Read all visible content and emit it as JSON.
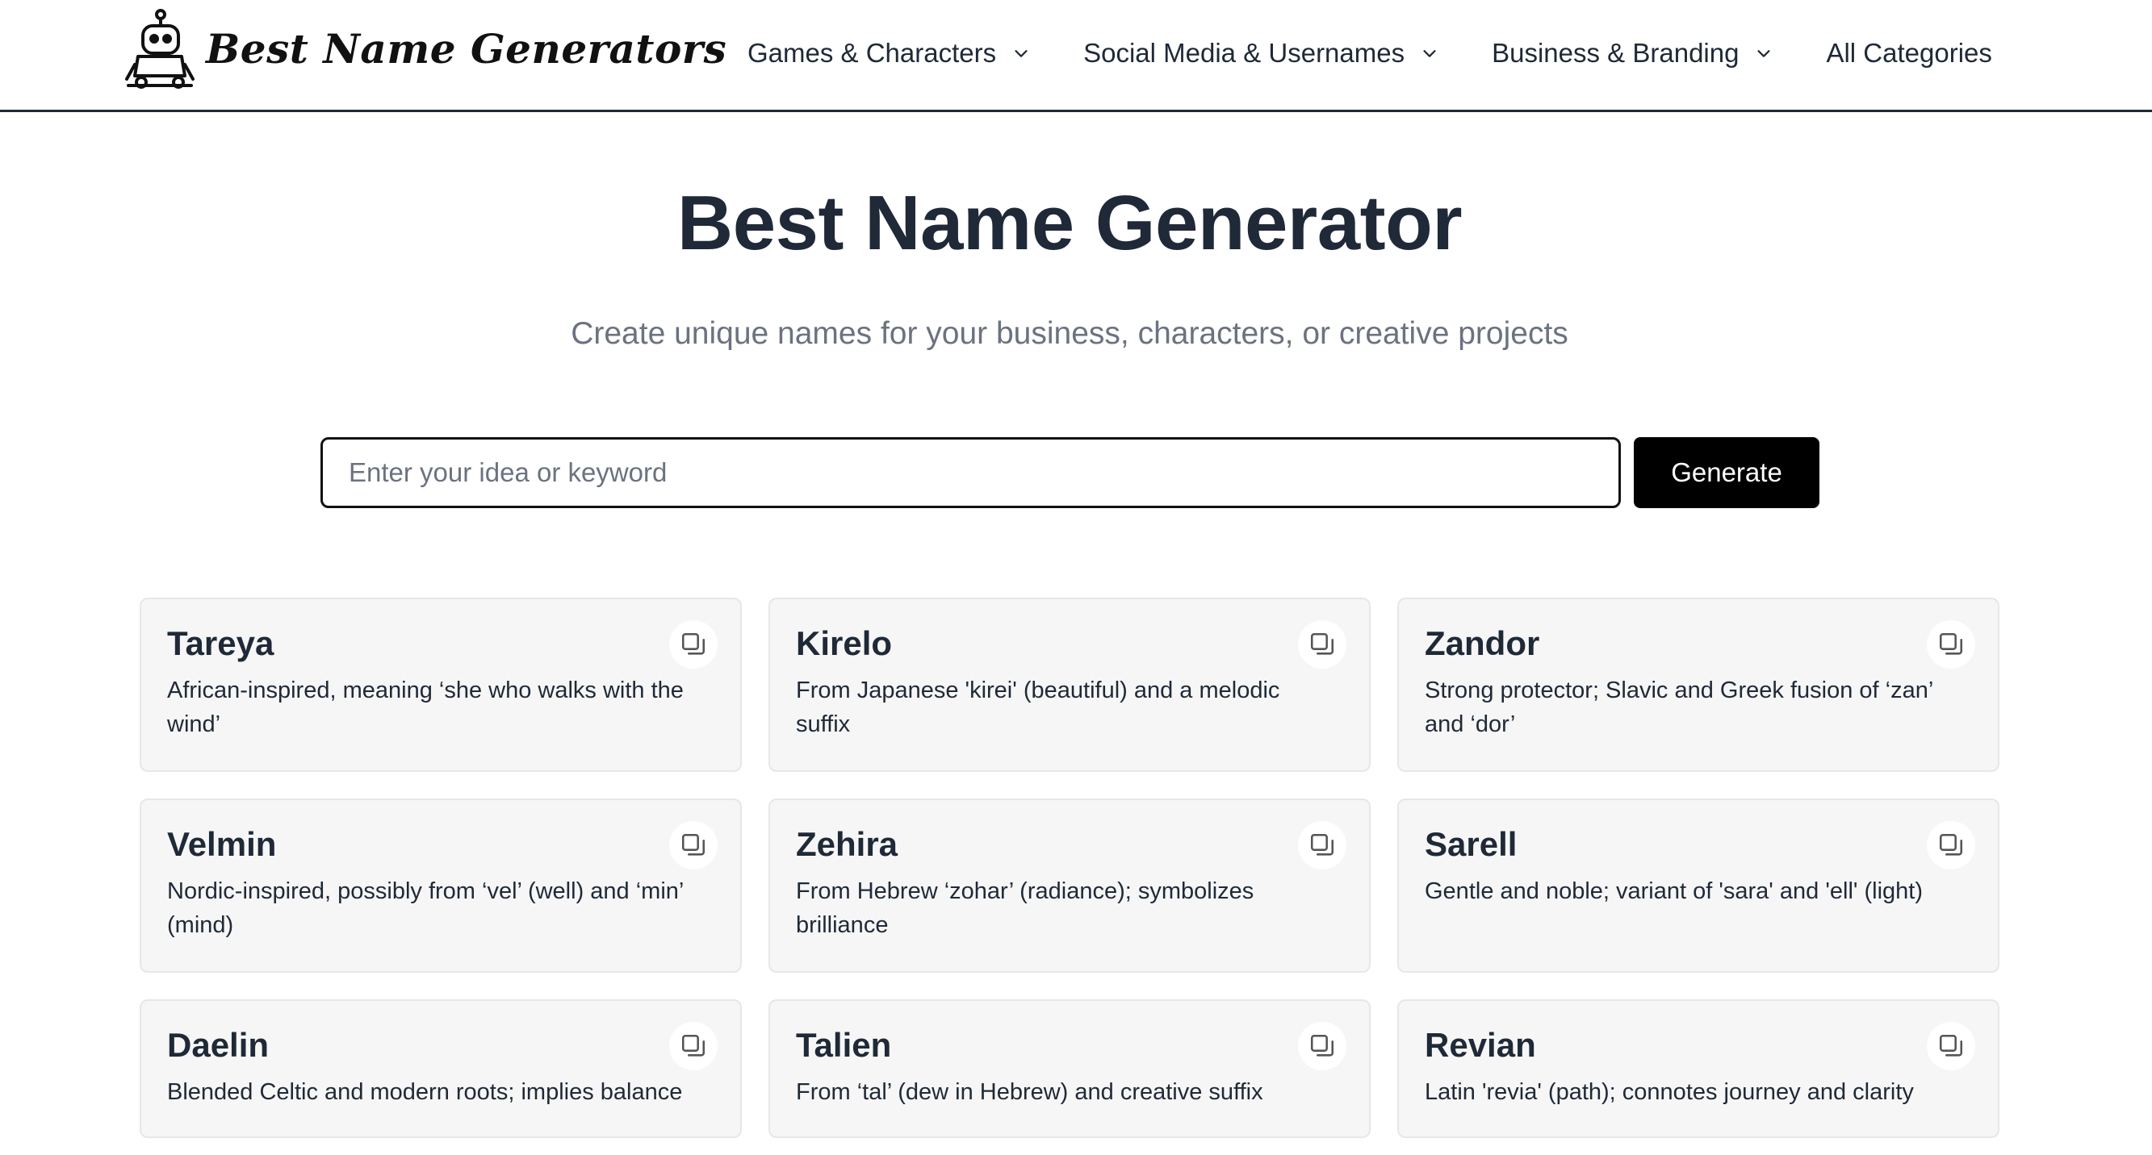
{
  "header": {
    "logo_text": "Best Name Generators",
    "nav": [
      {
        "label": "Games & Characters",
        "has_dropdown": true
      },
      {
        "label": "Social Media & Usernames",
        "has_dropdown": true
      },
      {
        "label": "Business & Branding",
        "has_dropdown": true
      },
      {
        "label": "All Categories",
        "has_dropdown": false
      }
    ]
  },
  "hero": {
    "title": "Best Name Generator",
    "subtitle": "Create unique names for your business, characters, or creative projects"
  },
  "search": {
    "placeholder": "Enter your idea or keyword",
    "value": "",
    "button_label": "Generate"
  },
  "results": [
    {
      "name": "Tareya",
      "description": "African-inspired, meaning ‘she who walks with the wind’"
    },
    {
      "name": "Kirelo",
      "description": "From Japanese 'kirei' (beautiful) and a melodic suffix"
    },
    {
      "name": "Zandor",
      "description": "Strong protector; Slavic and Greek fusion of ‘zan’ and ‘dor’"
    },
    {
      "name": "Velmin",
      "description": "Nordic-inspired, possibly from ‘vel’ (well) and ‘min’ (mind)"
    },
    {
      "name": "Zehira",
      "description": "From Hebrew ‘zohar’ (radiance); symbolizes brilliance"
    },
    {
      "name": "Sarell",
      "description": "Gentle and noble; variant of 'sara' and 'ell' (light)"
    },
    {
      "name": "Daelin",
      "description": "Blended Celtic and modern roots; implies balance"
    },
    {
      "name": "Talien",
      "description": "From ‘tal’ (dew in Hebrew) and creative suffix"
    },
    {
      "name": "Revian",
      "description": "Latin 'revia' (path); connotes journey and clarity"
    }
  ],
  "icons": {
    "logo": "robot-icon",
    "dropdown": "chevron-down-icon",
    "copy": "copy-icon"
  },
  "colors": {
    "text_primary": "#1f2937",
    "text_muted": "#6b7280",
    "button_bg": "#000000",
    "card_bg": "#f6f6f6"
  }
}
